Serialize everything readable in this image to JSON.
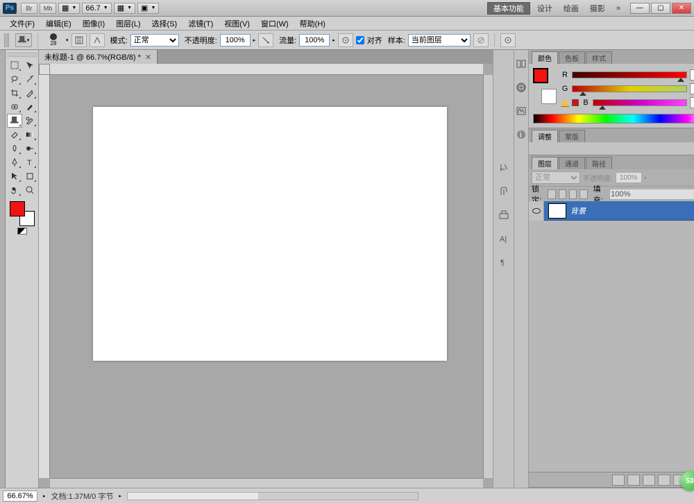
{
  "titlebar": {
    "ps": "Ps",
    "br": "Br",
    "mb": "Mb",
    "screen_dd": "▦",
    "zoom_dd": "66.7",
    "view_dd": "▦",
    "arrange_dd": "▣",
    "workspace_active": "基本功能",
    "ws_design": "设计",
    "ws_paint": "绘画",
    "ws_photo": "摄影",
    "ws_more": "»",
    "min": "—",
    "max": "▢",
    "close": "✕"
  },
  "menu": {
    "file": "文件(F)",
    "edit": "编辑(E)",
    "image": "图像(I)",
    "layer": "图层(L)",
    "select": "选择(S)",
    "filter": "滤镜(T)",
    "view": "视图(V)",
    "window": "窗口(W)",
    "help": "帮助(H)"
  },
  "options": {
    "brush_size": "28",
    "mode_label": "模式:",
    "mode_value": "正常",
    "opacity_label": "不透明度:",
    "opacity_value": "100%",
    "flow_label": "流量:",
    "flow_value": "100%",
    "aligned_label": "对齐",
    "sample_label": "样本:",
    "sample_value": "当前图层"
  },
  "document": {
    "tab_title": "未标题-1 @ 66.7%(RGB/8) *",
    "tab_close": "✕"
  },
  "status": {
    "zoom": "66.67%",
    "docsize": "文档:1.37M/0 字节"
  },
  "color_panel": {
    "tab_color": "颜色",
    "tab_swatches": "色板",
    "tab_styles": "样式",
    "r_label": "R",
    "g_label": "G",
    "b_label": "B",
    "r_value": "240",
    "g_value": "19",
    "b_value": "19"
  },
  "adjust_panel": {
    "tab_adjust": "调整",
    "tab_mask": "蒙版"
  },
  "layers_panel": {
    "tab_layers": "图层",
    "tab_channels": "通道",
    "tab_paths": "路径",
    "blend_value": "正常",
    "opacity_label": "不透明度:",
    "opacity_value": "100%",
    "lock_label": "锁定:",
    "fill_label": "填充:",
    "fill_value": "100%",
    "layer_bg": "背景"
  },
  "badge": "53"
}
